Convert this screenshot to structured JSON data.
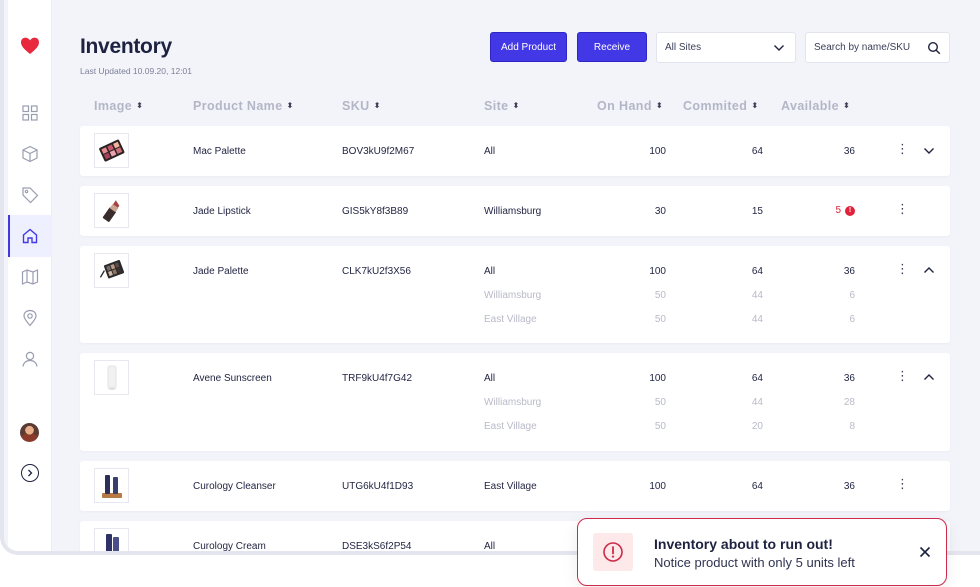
{
  "header": {
    "title": "Inventory",
    "last_updated": "Last Updated 10.09.20, 12:01",
    "add_product_label": "Add Product",
    "receive_label": "Receive",
    "site_select_value": "All Sites",
    "search_placeholder": "Search by name/SKU"
  },
  "columns": {
    "image": "Image",
    "name": "Product Name",
    "sku": "SKU",
    "site": "Site",
    "on_hand": "On Hand",
    "committed": "Commited",
    "available": "Available",
    "sort_glyph": "⬍"
  },
  "rows": [
    {
      "name": "Mac Palette",
      "sku": "BOV3kU9f2M67",
      "site": "All",
      "on_hand": "100",
      "committed": "64",
      "available": "36"
    },
    {
      "name": "Jade Lipstick",
      "sku": "GIS5kY8f3B89",
      "site": "Williamsburg",
      "on_hand": "30",
      "committed": "15",
      "available": "5",
      "warn": "!"
    },
    {
      "name": "Jade Palette",
      "sku": "CLK7kU2f3X56",
      "site": "All",
      "on_hand": "100",
      "committed": "64",
      "available": "36",
      "sub": [
        {
          "site": "Williamsburg",
          "on_hand": "50",
          "committed": "44",
          "available": "6"
        },
        {
          "site": "East Village",
          "on_hand": "50",
          "committed": "44",
          "available": "6"
        }
      ]
    },
    {
      "name": "Avene Sunscreen",
      "sku": "TRF9kU4f7G42",
      "site": "All",
      "on_hand": "100",
      "committed": "64",
      "available": "36",
      "sub": [
        {
          "site": "Williamsburg",
          "on_hand": "50",
          "committed": "44",
          "available": "28"
        },
        {
          "site": "East Village",
          "on_hand": "50",
          "committed": "20",
          "available": "8"
        }
      ]
    },
    {
      "name": "Curology Cleanser",
      "sku": "UTG6kU4f1D93",
      "site": "East Village",
      "on_hand": "100",
      "committed": "64",
      "available": "36"
    },
    {
      "name": "Curology Cream",
      "sku": "DSE3kS6f2P54",
      "site": "All"
    }
  ],
  "toast": {
    "title": "Inventory about to run out!",
    "message": "Notice product with only 5 units left"
  },
  "colors": {
    "accent": "#4338e6",
    "danger": "#e0233a",
    "brand_heart": "#e8283c"
  }
}
